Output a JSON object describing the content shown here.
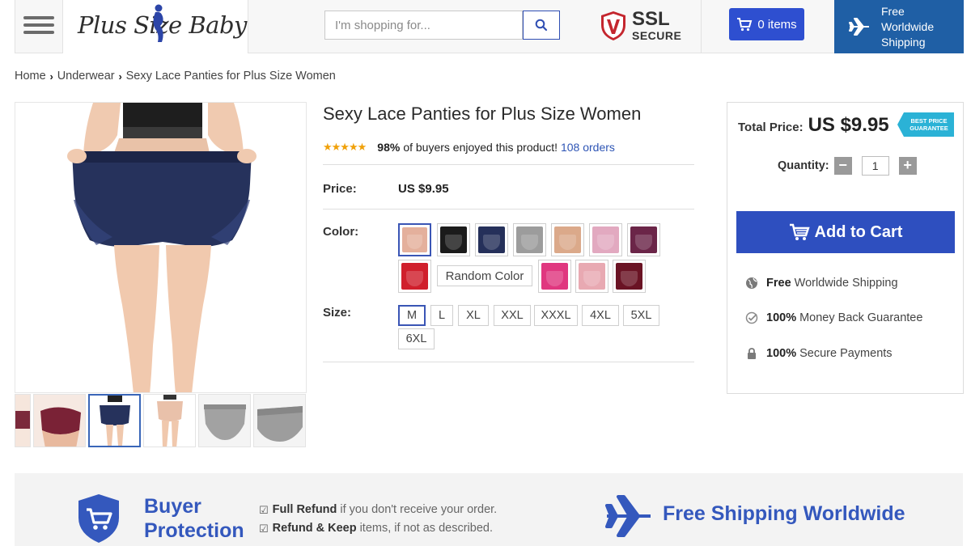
{
  "header": {
    "logo_text": "Plus Size Baby",
    "search_placeholder": "I'm shopping for...",
    "ssl_title": "SSL",
    "ssl_subtitle": "SECURE",
    "cart_label": "0 items",
    "shipping_label": "Free\nWorldwide\nShipping",
    "brand_color": "#2e4fd0",
    "shipping_bg": "#1f5fa5"
  },
  "breadcrumb": [
    "Home",
    "Underwear",
    "Sexy Lace Panties for Plus Size Women"
  ],
  "product": {
    "title": "Sexy Lace Panties for Plus Size Women",
    "rating_stars": "★★★★★",
    "rating_value": 4.5,
    "positive_pct": "98%",
    "positive_text": "of buyers enjoyed this product!",
    "orders": "108 orders",
    "price_label": "Price:",
    "price": "US $9.95",
    "color_label": "Color:",
    "colors": [
      {
        "name": "nude-pink",
        "hex": "#e4b09c",
        "selected": true
      },
      {
        "name": "black",
        "hex": "#1b1b1b"
      },
      {
        "name": "navy",
        "hex": "#25305a"
      },
      {
        "name": "grey",
        "hex": "#9c9c9c"
      },
      {
        "name": "beige",
        "hex": "#dba98a"
      },
      {
        "name": "light-pink",
        "hex": "#e2a9c0"
      },
      {
        "name": "purple",
        "hex": "#6b2548"
      },
      {
        "name": "red",
        "hex": "#d01f2c"
      },
      {
        "name": "hot-pink",
        "hex": "#e0377f"
      },
      {
        "name": "pale-pink",
        "hex": "#e8a9b2"
      },
      {
        "name": "wine",
        "hex": "#6a1324"
      }
    ],
    "random_color_label": "Random Color",
    "size_label": "Size:",
    "sizes": [
      {
        "label": "M",
        "selected": true
      },
      {
        "label": "L"
      },
      {
        "label": "XL"
      },
      {
        "label": "XXL"
      },
      {
        "label": "XXXL"
      },
      {
        "label": "4XL"
      },
      {
        "label": "5XL"
      },
      {
        "label": "6XL"
      }
    ]
  },
  "gallery": {
    "main_image": "navy-lace-panties-back-view",
    "thumbnails": [
      "partial",
      "wine",
      "navy",
      "nude",
      "grey",
      "grey-flat"
    ],
    "selected_thumbnail": 2
  },
  "buybox": {
    "total_label": "Total Price:",
    "total_value": "US $9.95",
    "badge": "BEST PRICE\nGUARANTEE",
    "quantity_label": "Quantity:",
    "quantity": "1",
    "minus": "−",
    "plus": "+",
    "add_to_cart": "Add to Cart",
    "perks": [
      {
        "bold": "Free",
        "text": "Worldwide Shipping",
        "icon": "globe-icon"
      },
      {
        "bold": "100%",
        "text": "Money Back Guarantee",
        "icon": "check-circle-icon"
      },
      {
        "bold": "100%",
        "text": "Secure Payments",
        "icon": "lock-icon"
      }
    ]
  },
  "banner": {
    "buyer_protection": "Buyer\nProtection",
    "refund_bold": "Full Refund",
    "refund_text": "if you don't receive your order.",
    "keep_bold": "Refund & Keep",
    "keep_text": "items, if not as described.",
    "free_shipping": "Free Shipping Worldwide",
    "accent": "#3458bd"
  }
}
